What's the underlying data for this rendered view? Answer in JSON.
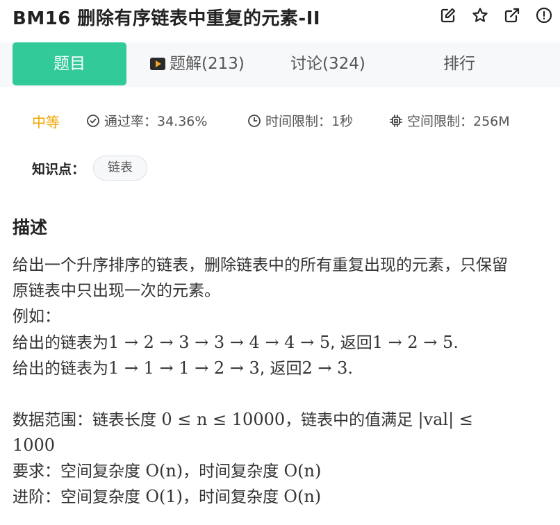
{
  "header": {
    "title": "BM16  删除有序链表中重复的元素-II",
    "icons": [
      "edit-icon",
      "star-icon",
      "share-icon",
      "report-icon"
    ]
  },
  "tabs": [
    {
      "label": "题目",
      "active": true
    },
    {
      "label": "题解(213)",
      "active": false
    },
    {
      "label": "讨论(324)",
      "active": false
    },
    {
      "label": "排行",
      "active": false
    }
  ],
  "meta": {
    "difficulty": "中等",
    "pass_rate": "通过率：34.36%",
    "time_limit": "时间限制：1秒",
    "space_limit": "空间限制：256M"
  },
  "knowledge": {
    "label": "知识点：",
    "tags": [
      "链表"
    ]
  },
  "description": {
    "title": "描述",
    "line1": "给出一个升序排序的链表，删除链表中的所有重复出现的元素，只保留",
    "line2": "原链表中只出现一次的元素。",
    "example_label": "例如：",
    "ex1_prefix": "给出的链表为",
    "ex1_chain": "1 → 2 → 3 → 3 → 4 → 4 → 5",
    "ex1_return": ", 返回",
    "ex1_result": "1 → 2 → 5.",
    "ex2_prefix": "给出的链表为",
    "ex2_chain": "1 → 1 → 1 → 2 → 3",
    "ex2_return": ", 返回",
    "ex2_result": "2 → 3.",
    "range_prefix": "数据范围：链表长度",
    "range_math": "0 ≤ n ≤ 10000",
    "range_mid": "，链表中的值满足",
    "range_math2": "|val| ≤",
    "range_math3": "1000",
    "req_prefix": "要求：空间复杂度",
    "req_space": "O(n)",
    "req_mid": "，时间复杂度",
    "req_time": "O(n)",
    "adv_prefix": "进阶：空间复杂度",
    "adv_space": "O(1)",
    "adv_mid": "，时间复杂度",
    "adv_time": "O(n)"
  },
  "colors": {
    "accent": "#32ca99",
    "difficulty": "#f0a500"
  }
}
